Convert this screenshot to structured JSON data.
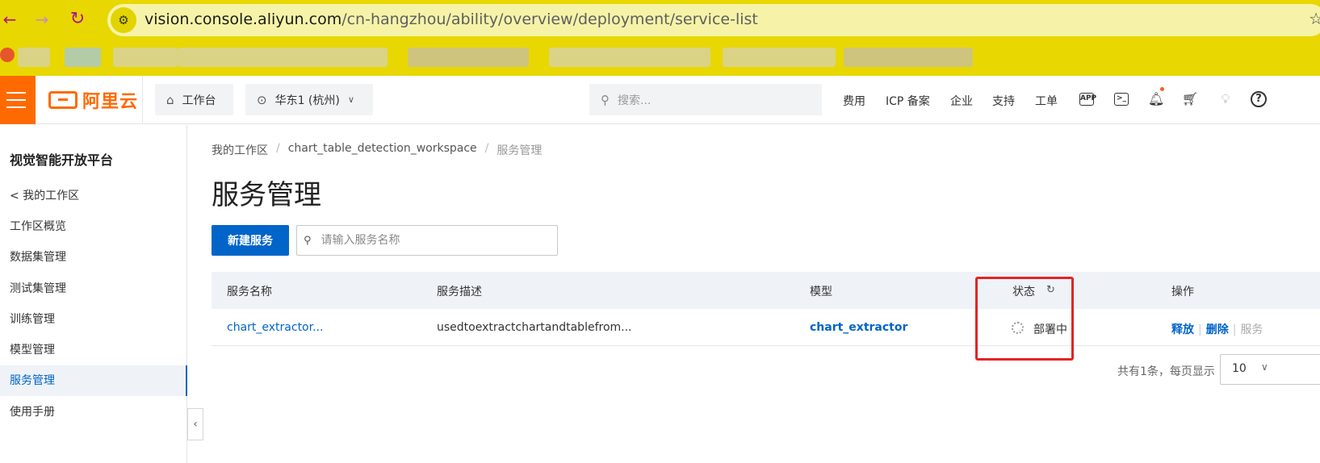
{
  "browser": {
    "back": "←",
    "forward": "→",
    "reload": "↻",
    "url_host": "vision.console.aliyun.com",
    "url_path": "/cn-hangzhou/ability/overview/deployment/service-list",
    "star": "☆"
  },
  "topnav": {
    "logo_text": "阿里云",
    "workbench": "工作台",
    "region": "华东1 (杭州)",
    "search_placeholder": "搜索...",
    "links": [
      "费用",
      "ICP 备案",
      "企业",
      "支持",
      "工单"
    ],
    "icons": [
      "app-icon",
      "terminal-icon",
      "bell-icon",
      "cart-icon",
      "bulb-icon",
      "help-icon"
    ]
  },
  "sidebar": {
    "title": "视觉智能开放平台",
    "items": [
      {
        "label": "< 我的工作区"
      },
      {
        "label": "工作区概览"
      },
      {
        "label": "数据集管理"
      },
      {
        "label": "测试集管理"
      },
      {
        "label": "训练管理"
      },
      {
        "label": "模型管理"
      },
      {
        "label": "服务管理",
        "active": true
      },
      {
        "label": "使用手册"
      }
    ]
  },
  "breadcrumb": [
    "我的工作区",
    "chart_table_detection_workspace",
    "服务管理"
  ],
  "page_title": "服务管理",
  "toolbar": {
    "create_label": "新建服务",
    "search_placeholder": "请输入服务名称"
  },
  "table": {
    "headers": [
      "服务名称",
      "服务描述",
      "模型",
      "状态",
      "操作"
    ],
    "rows": [
      {
        "name": "chart_extractor...",
        "description": "usedtoextractchartandtablefrom...",
        "model": "chart_extractor",
        "status": "部署中",
        "actions": [
          "释放",
          "删除",
          "服务"
        ]
      }
    ]
  },
  "pagination": {
    "summary": "共有1条，每页显示",
    "page_size": "10"
  },
  "colors": {
    "accent": "#0064c8",
    "brand": "#ff6a00",
    "highlight": "#e52323",
    "browser_bar": "#e8d700"
  }
}
